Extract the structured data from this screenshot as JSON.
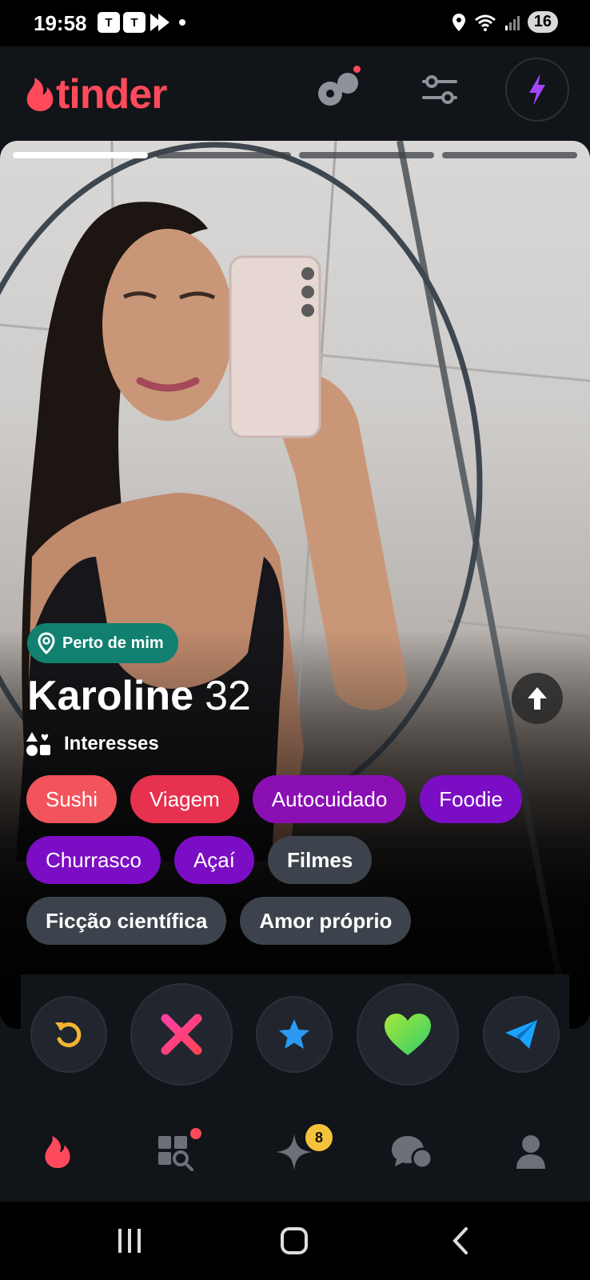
{
  "status_bar": {
    "time": "19:58",
    "battery": "16",
    "teams_label": "T"
  },
  "header": {
    "logo_text": "tinder"
  },
  "card": {
    "photo_count": 4,
    "active_photo": 1,
    "near_badge": "Perto de mim",
    "name": "Karoline",
    "age": "32",
    "interests_title": "Interesses",
    "interests": [
      {
        "label": "Sushi",
        "color": "#f2545b"
      },
      {
        "label": "Viagem",
        "color": "#e6324f"
      },
      {
        "label": "Autocuidado",
        "color": "#8a0fb3"
      },
      {
        "label": "Foodie",
        "color": "#7b0ec4"
      },
      {
        "label": "Churrasco",
        "color": "#7b0ec4"
      },
      {
        "label": "Açaí",
        "color": "#7b0ec4"
      },
      {
        "label": "Filmes",
        "color": "#3d434c"
      },
      {
        "label": "Ficção científica",
        "color": "#3d434c"
      },
      {
        "label": "Amor próprio",
        "color": "#3d434c"
      }
    ]
  },
  "actions": [
    "rewind-icon",
    "nope-icon",
    "super-like-icon",
    "like-icon",
    "message-icon"
  ],
  "bottom_nav": {
    "likes_badge": "8"
  },
  "colors": {
    "brand": "#fe4a5b",
    "boost": "#a645ff",
    "like": "#4cd964",
    "star": "#2a9af4",
    "rewind": "#f5b530",
    "near_badge": "#118070"
  }
}
